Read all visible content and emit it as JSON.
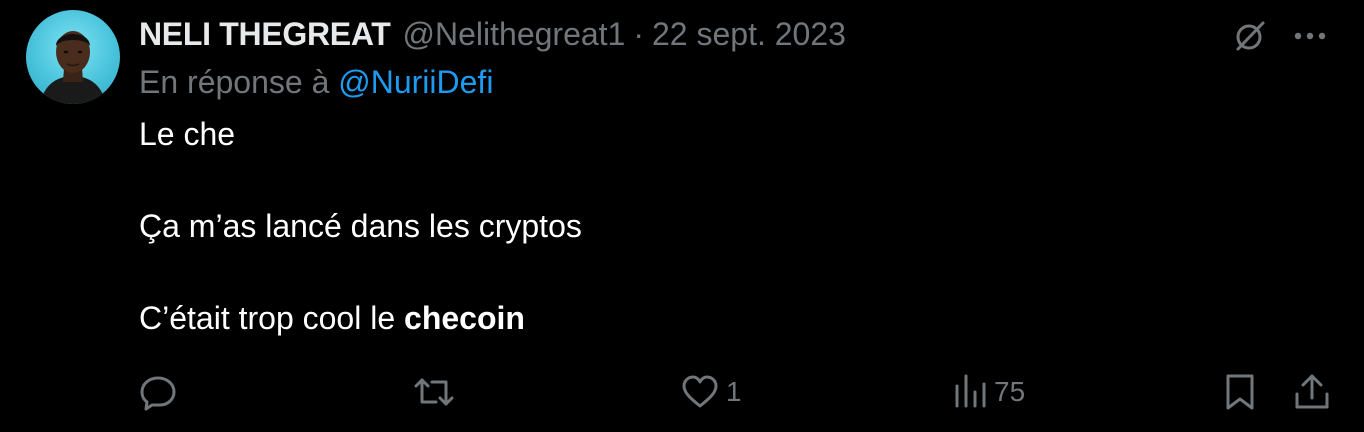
{
  "tweet": {
    "author": {
      "display_name": "NELI THEGREAT",
      "handle": "@Nelithegreat1"
    },
    "separator": "·",
    "date": "22 sept. 2023",
    "reply_to": {
      "prefix": "En réponse à",
      "handle": "@NuriiDefi"
    },
    "lines": [
      "Le che",
      "Ça m’as lancé dans les cryptos"
    ],
    "last_line": {
      "normal": "C’était trop cool le ",
      "bold": "checoin"
    },
    "actions": {
      "reply": {
        "icon": "reply-icon",
        "count": ""
      },
      "retweet": {
        "icon": "retweet-icon",
        "count": ""
      },
      "like": {
        "icon": "heart-icon",
        "count": "1"
      },
      "views": {
        "icon": "views-icon",
        "count": "75"
      },
      "bookmark": {
        "icon": "bookmark-icon"
      },
      "share": {
        "icon": "share-icon"
      }
    },
    "top_icons": [
      "grok-icon",
      "more-icon"
    ]
  },
  "colors": {
    "background": "#000000",
    "text": "#e7e9ea",
    "muted": "#71767b",
    "link": "#1d9bf0",
    "avatar_bg": "#49c3dc"
  }
}
